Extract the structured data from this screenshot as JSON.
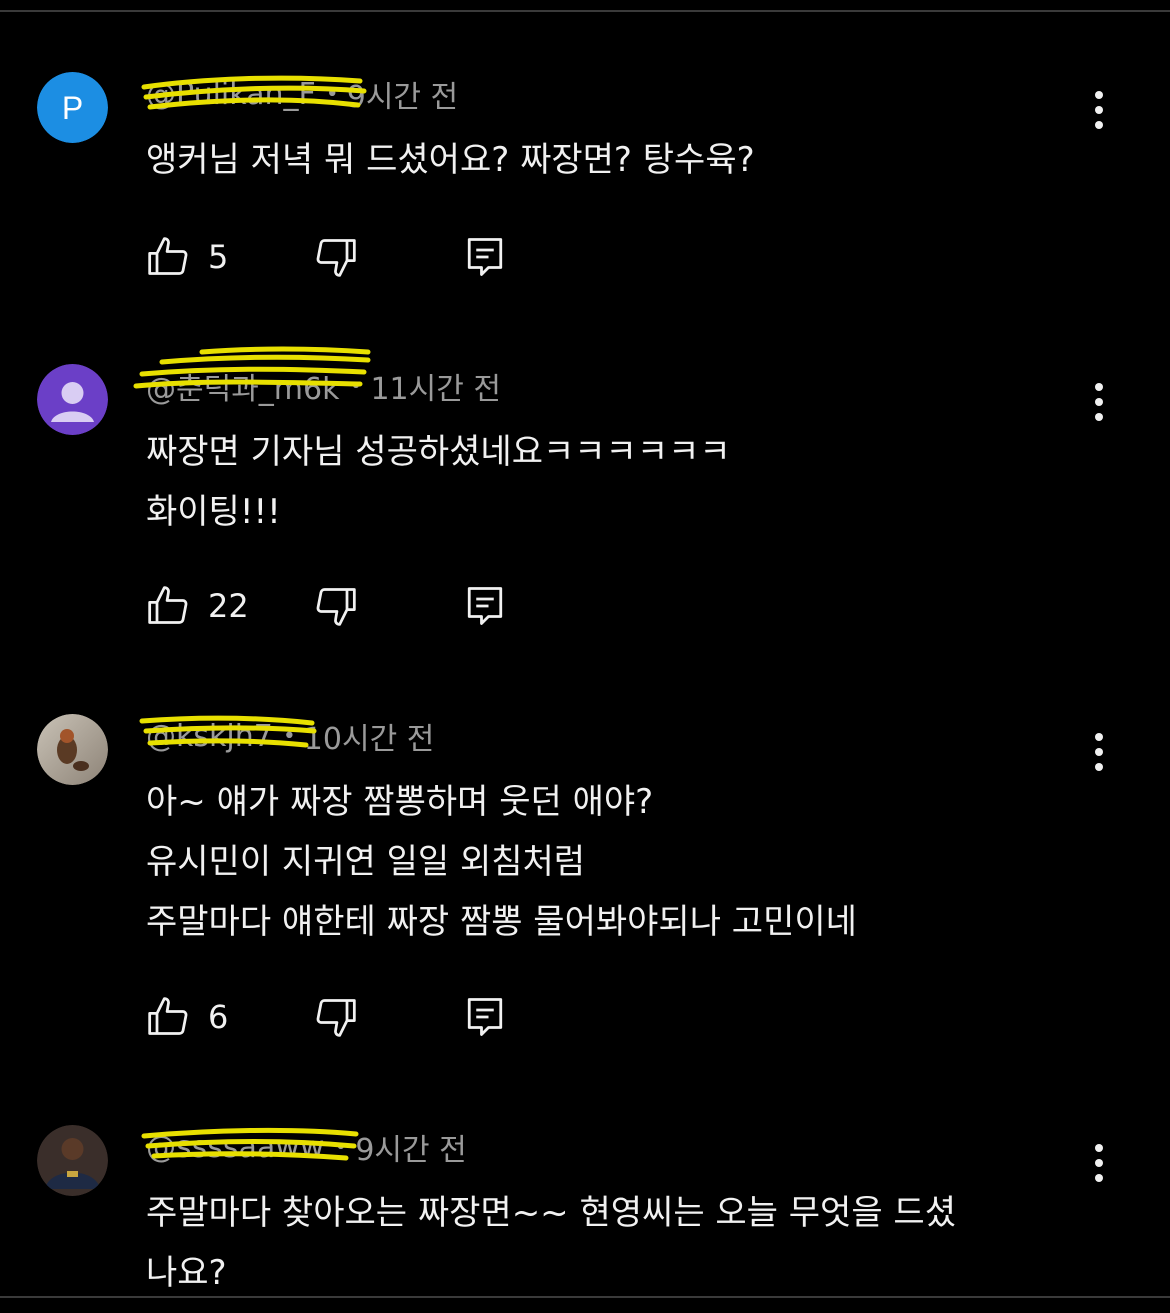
{
  "colors": {
    "background": "#000000",
    "text": "#f1f1f1",
    "meta": "#9a9a9a",
    "highlighter": "#e8e000"
  },
  "comments": [
    {
      "avatar_letter": "P",
      "avatar_color": "#1c8ee3",
      "handle": "@Pulikan_F",
      "time": "9시간 전",
      "lines": [
        "앵커님 저녁 뭐 드셨어요? 짜장면? 탕수육?"
      ],
      "likes": "5",
      "icons": [
        "like-icon",
        "dislike-icon",
        "reply-icon",
        "more-vert-icon"
      ]
    },
    {
      "avatar_letter": "",
      "avatar_color": "#6b3fc7",
      "handle": "@춘덕과_m6k",
      "time": "11시간 전",
      "lines": [
        "짜장면 기자님 성공하셨네요ㅋㅋㅋㅋㅋㅋ",
        "화이팅!!!"
      ],
      "likes": "22",
      "icons": [
        "like-icon",
        "dislike-icon",
        "reply-icon",
        "more-vert-icon"
      ]
    },
    {
      "avatar_letter": "",
      "avatar_color": "#7a6a5a",
      "handle": "@kskjh7",
      "time": "10시간 전",
      "lines": [
        "아~ 얘가 짜장 짬뽕하며 웃던 애야?",
        "유시민이 지귀연 일일 외침처럼",
        "주말마다 얘한테 짜장 짬뽕 물어봐야되나 고민이네"
      ],
      "likes": "6",
      "icons": [
        "like-icon",
        "dislike-icon",
        "reply-icon",
        "more-vert-icon"
      ]
    },
    {
      "avatar_letter": "",
      "avatar_color": "#3a2e2a",
      "handle": "@ssssaaww",
      "time": "9시간 전",
      "lines": [
        "주말마다 찾아오는 짜장면~~ 현영씨는 오늘 무엇을 드셨",
        "나요?"
      ],
      "likes": "",
      "icons": [
        "more-vert-icon"
      ]
    }
  ]
}
